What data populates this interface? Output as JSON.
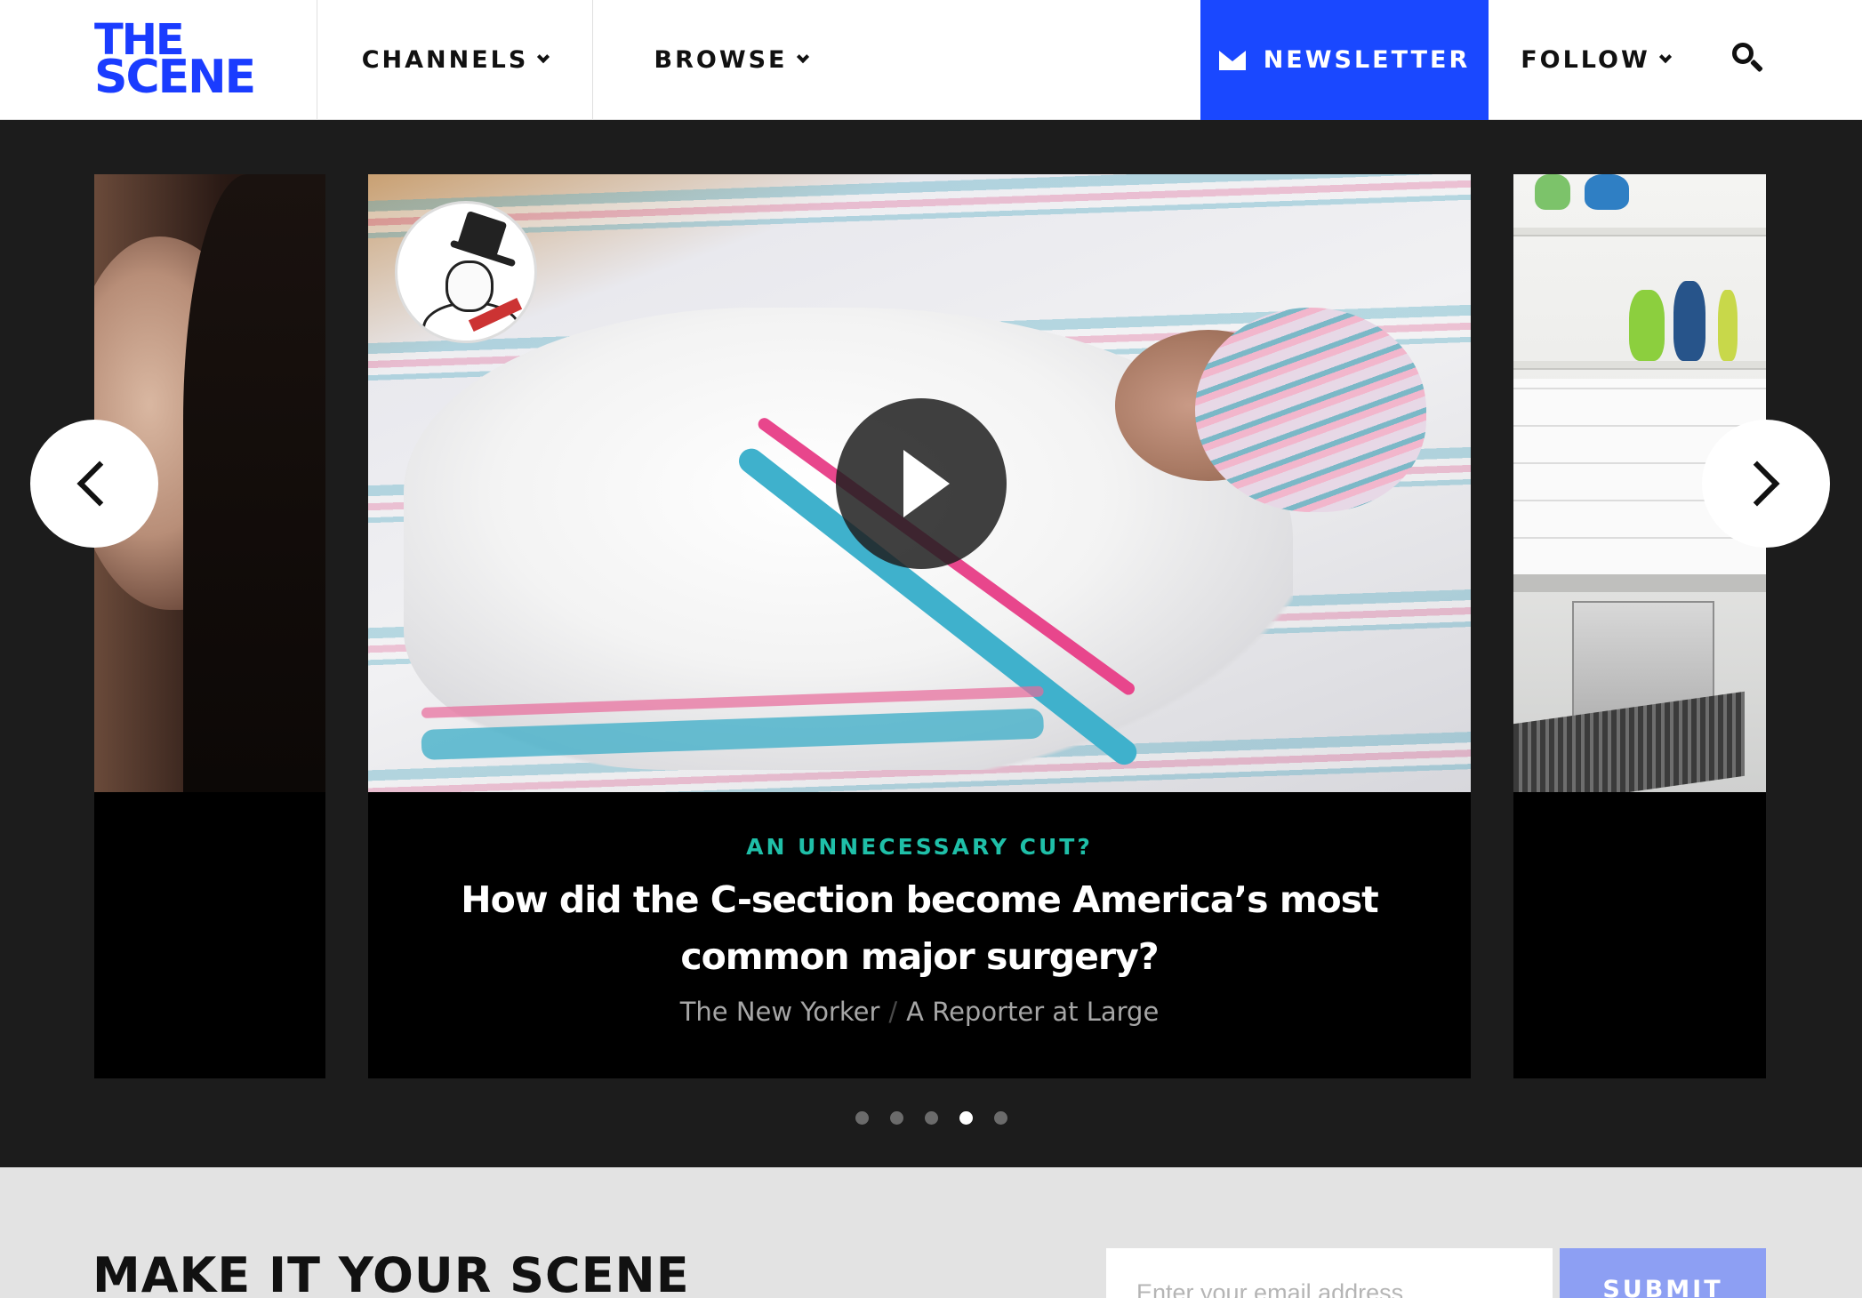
{
  "header": {
    "logo_line1": "THE",
    "logo_line2": "SCENE",
    "nav": {
      "channels_label": "CHANNELS",
      "browse_label": "BROWSE",
      "newsletter_label": "NEWSLETTER",
      "follow_label": "FOLLOW"
    },
    "icons": {
      "newsletter": "mail-icon",
      "search": "search-icon",
      "dropdown": "chevron-down-icon"
    }
  },
  "carousel": {
    "featured": {
      "kicker": "AN UNNECESSARY CUT?",
      "headline": "How did the C-section become America’s most common major surgery?",
      "source": "The New Yorker",
      "series": "A Reporter at Large",
      "separator": "/"
    },
    "dots_total": 5,
    "active_dot": 4
  },
  "signup": {
    "title": "MAKE IT YOUR SCENE",
    "email_placeholder": "Enter your email address",
    "submit_label": "SUBMIT"
  },
  "colors": {
    "brand_blue": "#1a48ff",
    "kicker_teal": "#1fbfa8",
    "submit_blue": "#8d9ff3"
  }
}
